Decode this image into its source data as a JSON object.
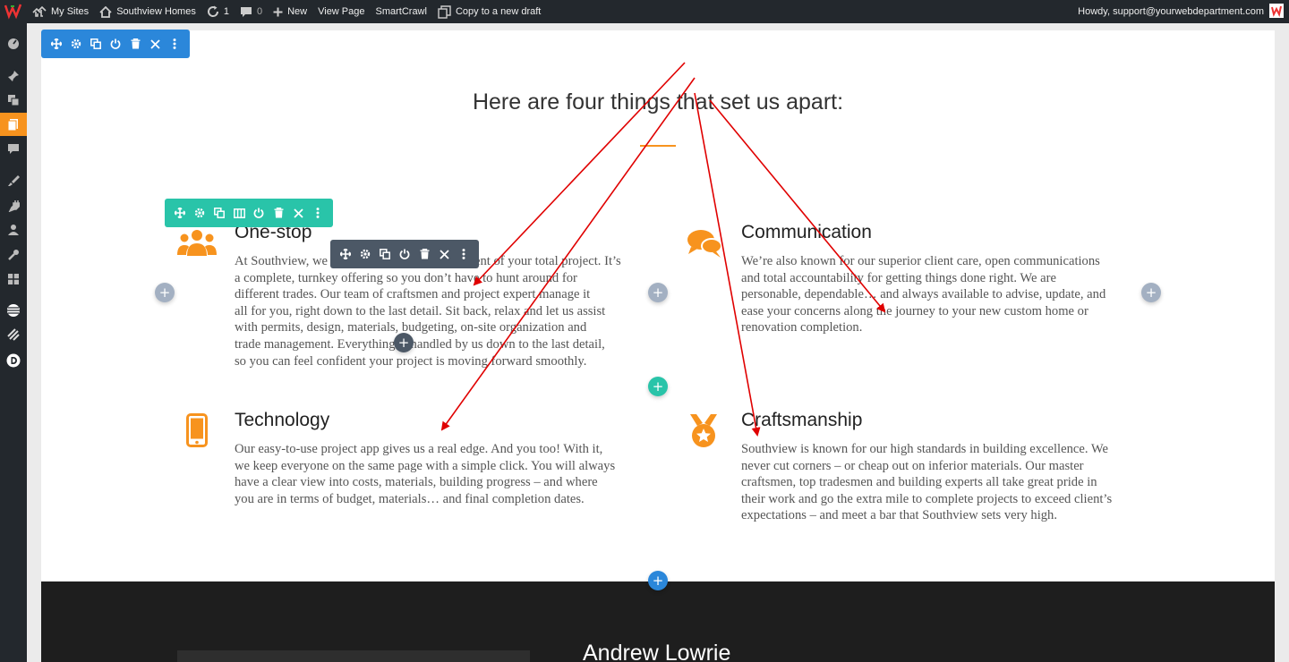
{
  "adminbar": {
    "my_sites": "My Sites",
    "site_name": "Southview Homes",
    "updates_count": "1",
    "comments_count": "0",
    "new_label": "New",
    "view_page": "View Page",
    "smartcrawl": "SmartCrawl",
    "copy_draft": "Copy to a new draft",
    "howdy": "Howdy, support@yourwebdepartment.com"
  },
  "section": {
    "heading": "Here are four things that set us apart:"
  },
  "blurbs": [
    {
      "title": "One-stop",
      "icon": "users-icon",
      "lines": [
        "At Southview, we",
        "a complete, turnkey offering so you don’t have to hunt around for",
        "different trades. Our team of craftsmen and project expert manage it",
        "all for you, right down to the last detail. Sit back, relax and let us assist",
        "with permits, design, materials, budgeting, on-site organization and",
        "trade management. Everything is handled by us down to the last detail,",
        "so you can feel confident your project is moving forward smoothly."
      ],
      "line1_tail": "ent of your total project. It’s"
    },
    {
      "title": "Communication",
      "icon": "chat-bubbles-icon",
      "lines": [
        "We’re also known for our superior client care, open communications",
        "and total accountability for getting things done right.  We are",
        "personable, dependable… and always available to advise, update, and",
        "ease your concerns along the journey to your new custom home or",
        "renovation completion."
      ]
    },
    {
      "title": "Technology",
      "icon": "mobile-phone-icon",
      "lines": [
        "Our easy-to-use project app gives us a real edge. And you too!  With it,",
        "we keep everyone on the same page with a simple click. You will always",
        "have a clear view into costs, materials, building progress – and where",
        "you are in terms of budget, materials… and final completion dates."
      ]
    },
    {
      "title": "Craftsmanship",
      "icon": "award-medal-icon",
      "lines": [
        "Southview is known for our high standards in building excellence. We",
        "never cut corners – or cheap out on inferior materials. Our master",
        "craftsmen, top tradesmen and building experts all take great pride in",
        "their work and go the extra mile to complete projects to exceed client’s",
        "expectations – and meet a bar that Southview sets very high."
      ]
    }
  ],
  "next_section": {
    "name": "Andrew Lowrie"
  },
  "colors": {
    "accent_orange": "#f7931e",
    "builder_blue": "#2b87da",
    "builder_teal": "#29c4a9",
    "builder_dark": "#4c5866",
    "annotation_arrow": "#e00000",
    "adminbar": "#23282d"
  },
  "plus_symbol": "+"
}
